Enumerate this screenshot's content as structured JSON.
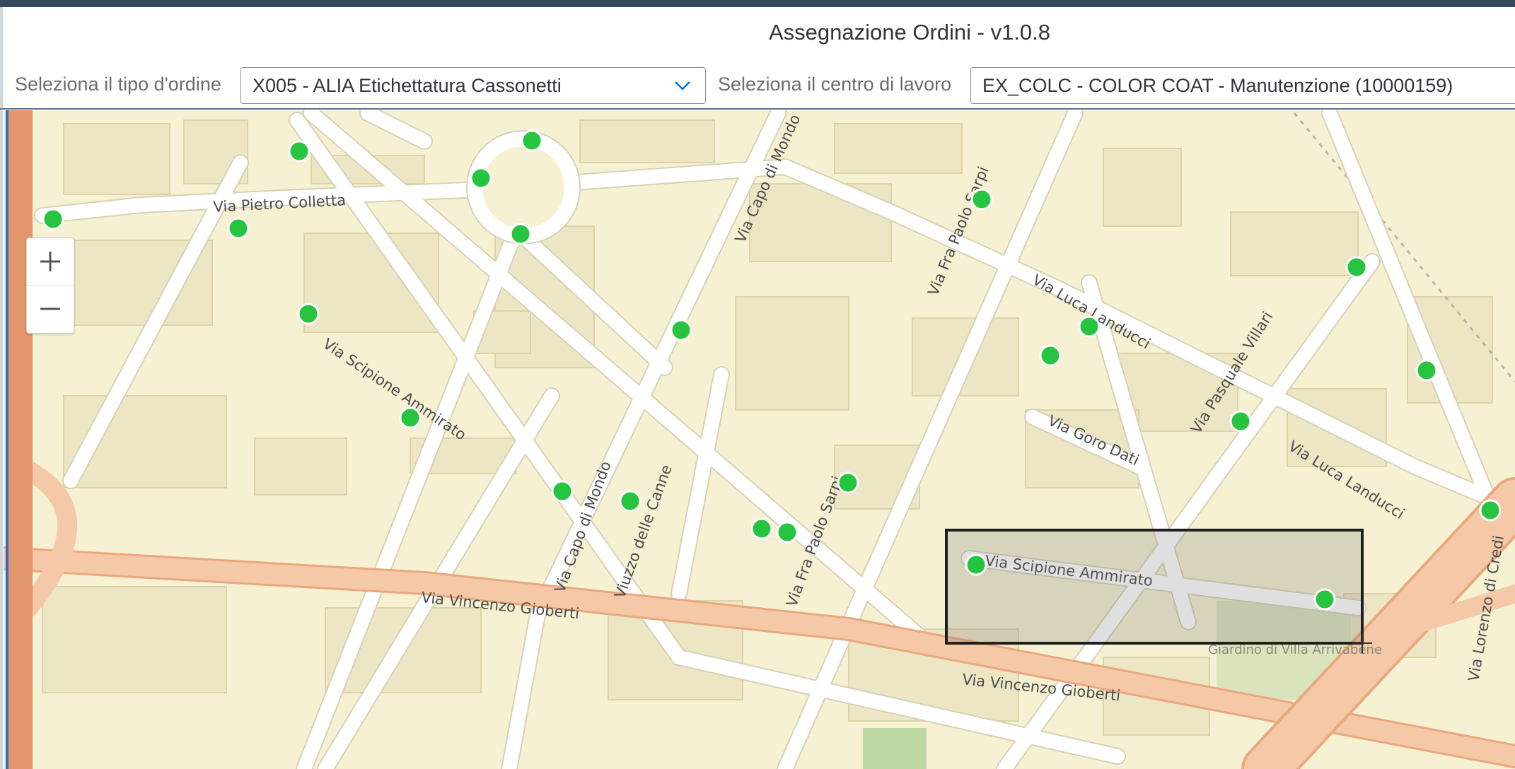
{
  "app": {
    "title": "Assegnazione Ordini - v1.0.8"
  },
  "filters": {
    "order_type_label": "Seleziona il tipo d'ordine",
    "order_type_value": "X005 - ALIA Etichettatura Cassonetti",
    "work_center_label": "Seleziona il centro di lavoro",
    "work_center_value": "EX_COLC - COLOR COAT - Manutenzione (10000159)"
  },
  "map": {
    "zoom_in": "+",
    "zoom_out": "−",
    "streets": [
      "Via Pietro Colletta",
      "Via Scipione Ammirato",
      "Via Capo di Mondo",
      "Via Fra Paolo Sarpi",
      "Via Luca Landucci",
      "Via Pasquale Villari",
      "Via Goro Dati",
      "Via Vincenzo Gioberti",
      "Viuzzo delle Canne",
      "Via Lorenzo di Credi",
      "Giardino di Villa Arrivabene"
    ],
    "marker_color": "#27c43f",
    "selection_color": "#1f1f1f"
  }
}
